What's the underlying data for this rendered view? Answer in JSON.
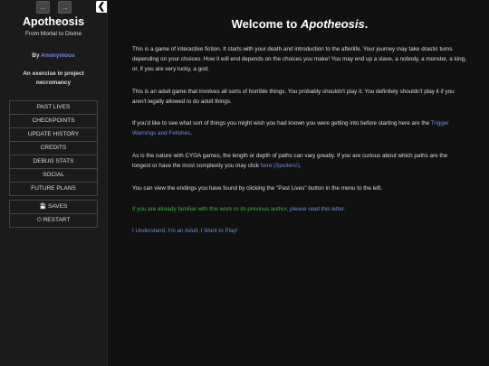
{
  "sidebar": {
    "history_back": "←",
    "history_forward": "→",
    "toggle": "❮",
    "title": "Apotheosis",
    "subtitle": "From Mortal to Divine",
    "author_prefix": "By ",
    "author_name": "Anonymous",
    "tagline": "An exercise in project necromancy",
    "story_menu": [
      "PAST LIVES",
      "CHECKPOINTS",
      "UPDATE HISTORY",
      "CREDITS",
      "DEBUG STATS",
      "SOCIAL",
      "FUTURE PLANS"
    ],
    "saves_icon": "💾",
    "saves_label": "SAVES",
    "restart_icon": "⏻",
    "restart_label": "RESTART"
  },
  "passage": {
    "title_prefix": "Welcome to ",
    "title_em": "Apotheosis",
    "title_suffix": ".",
    "p1": "This is a game of interactive fiction. It starts with your death and introduction to the afterlife. Your journey may take drastic turns depending on your choices. How it will end depends on the choices you make! You may end up a slave, a nobody, a monster, a king, or, if you are very lucky, a god.",
    "p2": "This is an adult game that involves all sorts of horrible things. You probably shouldn't play it. You definitely shouldn't play it if you aren't legally allowed to do adult things.",
    "p3_text": "If you'd like to see what sort of things you might wish you had known you were getting into before starting here are the ",
    "p3_link": "Trigger Warnings and Fetishes",
    "p3_end": ".",
    "p4_text": "As is the nature with CYOA games, the length or depth of paths can vary greatly. If you are curious about which paths are the longest or have the most complexity you may click ",
    "p4_link": "here (Spoilers!)",
    "p4_end": ".",
    "p5": "You can view the endings you have found by clicking the \"Past Lives\" button in the menu to the left.",
    "p6_green": "If you are already familiar with this work or its previous author, ",
    "p6_link": "please read this letter",
    "p6_end": ".",
    "p7_link": "I Understand, I'm an Adult, I Want to Play!"
  }
}
